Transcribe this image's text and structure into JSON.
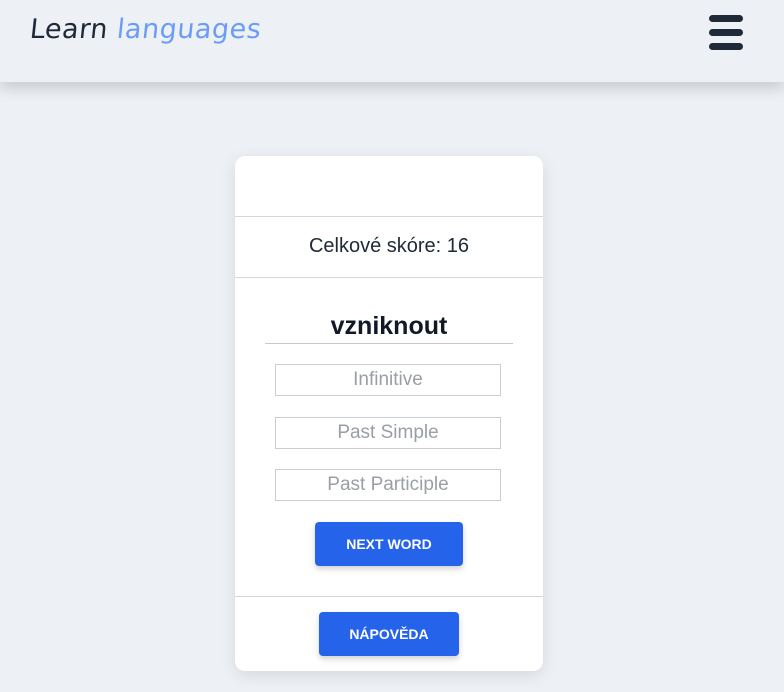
{
  "header": {
    "logo_word1": "Learn",
    "logo_word2": "languages",
    "menu_icon": "hamburger-menu-icon"
  },
  "card": {
    "score_text": "Celkové skóre: 16",
    "word": "vzniknout",
    "fields": {
      "infinitive_placeholder": "Infinitive",
      "past_simple_placeholder": "Past Simple",
      "past_participle_placeholder": "Past Participle"
    },
    "next_button": "NEXT WORD",
    "hint_button": "NÁPOVĚDA"
  },
  "colors": {
    "background": "#edf0f4",
    "accent": "#2563eb",
    "logo_accent": "#6b9cf8",
    "text_dark": "#1f2937"
  }
}
